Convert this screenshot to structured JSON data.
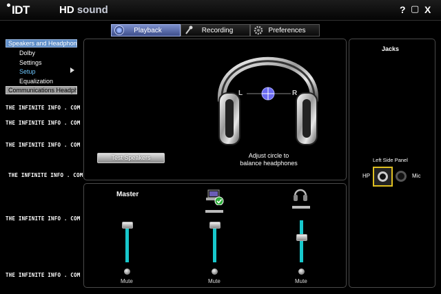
{
  "title_bar": {
    "brand": "IDT",
    "product_hd": "HD",
    "product_sound": "sound",
    "help": "?",
    "minimize": "▢",
    "close": "X"
  },
  "tabs": [
    {
      "label": "Playback",
      "active": true,
      "icon": "speaker-icon"
    },
    {
      "label": "Recording",
      "active": false,
      "icon": "microphone-icon"
    },
    {
      "label": "Preferences",
      "active": false,
      "icon": "gear-icon"
    }
  ],
  "sidebar": {
    "speakers": "Speakers and Headphones",
    "sub": [
      "Dolby",
      "Settings",
      "Setup",
      "Equalization"
    ],
    "current_sub": "Setup",
    "communications": "Communications Headphones"
  },
  "watermarks": [
    "THE INFINITE INFO . COM",
    "THE INFINITE INFO . COM",
    "THE INFINITE INFO . COM",
    "THE INFINITE INFO . COM",
    "THE INFINITE INFO . COM",
    "THE INFINITE INFO . COM"
  ],
  "setup_panel": {
    "test_button": "Test Speakers",
    "left_label": "L",
    "right_label": "R",
    "caption_line1": "Adjust circle to",
    "caption_line2": "balance headphones"
  },
  "mixer": {
    "master_label": "Master",
    "mute_label": "Mute",
    "channels": [
      {
        "name": "master",
        "level": 0.94
      },
      {
        "name": "speakers",
        "level": 0.94
      },
      {
        "name": "headphones",
        "level": 0.72
      }
    ]
  },
  "jacks": {
    "title": "Jacks",
    "panel_label": "Left Side Panel",
    "hp": "HP",
    "mic": "Mic"
  },
  "colors": {
    "accent": "#17c8cc",
    "tab_active": "#5f72b0",
    "sidebar_selected": "#5f8ec8",
    "jack_highlight": "#e0c020"
  }
}
